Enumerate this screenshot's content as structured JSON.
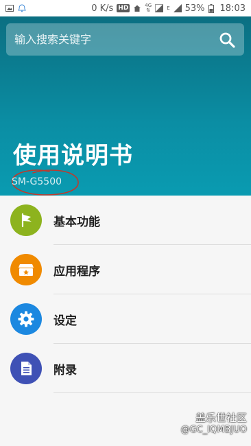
{
  "status_bar": {
    "network_speed": "0 K/s",
    "hd_badge": "HD",
    "network_type": "4G",
    "signal_label": "E",
    "battery_percent": "53%",
    "time": "18:03"
  },
  "search": {
    "placeholder": "输入搜索关键字"
  },
  "header": {
    "title": "使用说明书",
    "model": "SM-G5500"
  },
  "menu": {
    "items": [
      {
        "label": "基本功能",
        "icon": "flag-icon",
        "color": "#8db31e"
      },
      {
        "label": "应用程序",
        "icon": "box-icon",
        "color": "#f08a00"
      },
      {
        "label": "设定",
        "icon": "gear-icon",
        "color": "#1c88e0"
      },
      {
        "label": "附录",
        "icon": "document-icon",
        "color": "#3f51b5"
      }
    ]
  },
  "watermark": {
    "line1": "盖乐世社区",
    "line2": "@GC_IQMBJUO"
  },
  "colors": {
    "header_top": "#0b6f82",
    "header_bottom": "#0a9bb1",
    "annotation_red": "#c0392b"
  }
}
